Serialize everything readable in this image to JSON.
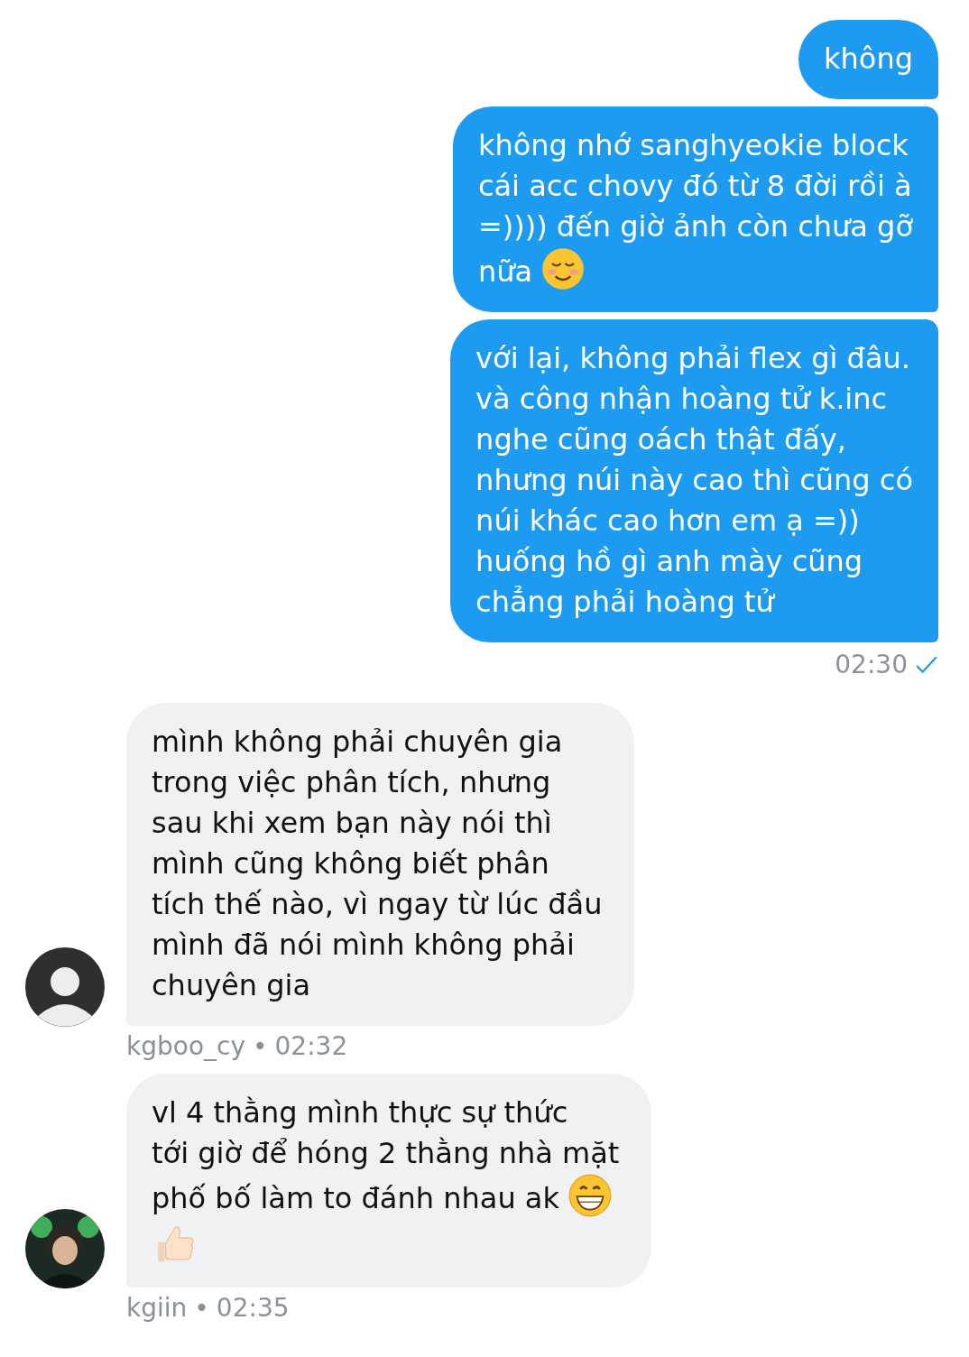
{
  "messages": [
    {
      "kind": "sent",
      "parts": [
        {
          "kind": "text",
          "text": "không"
        }
      ]
    },
    {
      "kind": "sent",
      "parts": [
        {
          "kind": "text",
          "text": "không nhớ sanghyeokie block\ncái acc chovy đó từ 8 đời rồi à\n=)))) đến giờ ảnh còn chưa gỡ"
        },
        {
          "kind": "break"
        },
        {
          "kind": "text",
          "text": "nữa"
        },
        {
          "kind": "smile"
        }
      ]
    },
    {
      "kind": "sent",
      "parts": [
        {
          "kind": "text",
          "text": "với lại, không phải flex gì đâu.\nvà công nhận hoàng tử k.inc\nnghe cũng oách thật đấy,\nnhưng núi này cao thì cũng có\nnúi khác cao hơn em ạ =))\nhuống hồ gì anh mày cũng\nchẳng phải hoàng tử"
        }
      ],
      "time": "02:30",
      "read": true
    },
    {
      "kind": "received",
      "avatar": {
        "kind": "silhouette"
      },
      "parts": [
        {
          "kind": "text",
          "text": "mình không phải chuyên gia\ntrong việc phân tích, nhưng\nsau khi xem bạn này nói thì\nmình cũng không biết phân\ntích thế nào, vì ngay từ lúc đầu\nmình đã nói mình không phải\nchuyên gia"
        }
      ],
      "sender": "kgboo_cy",
      "separator": "•",
      "time": "02:32"
    },
    {
      "kind": "received",
      "parts": [
        {
          "kind": "text",
          "text": "vl 4 thằng mình thực sự thức\ntới giờ để hóng 2 thằng nhà mặt"
        },
        {
          "kind": "break"
        },
        {
          "kind": "text",
          "text": "phố bố làm to đánh nhau ak"
        },
        {
          "kind": "grin"
        },
        {
          "kind": "break"
        },
        {
          "kind": "thumbs"
        }
      ],
      "sender": "kgiin",
      "separator": "•",
      "time": "02:35"
    }
  ]
}
